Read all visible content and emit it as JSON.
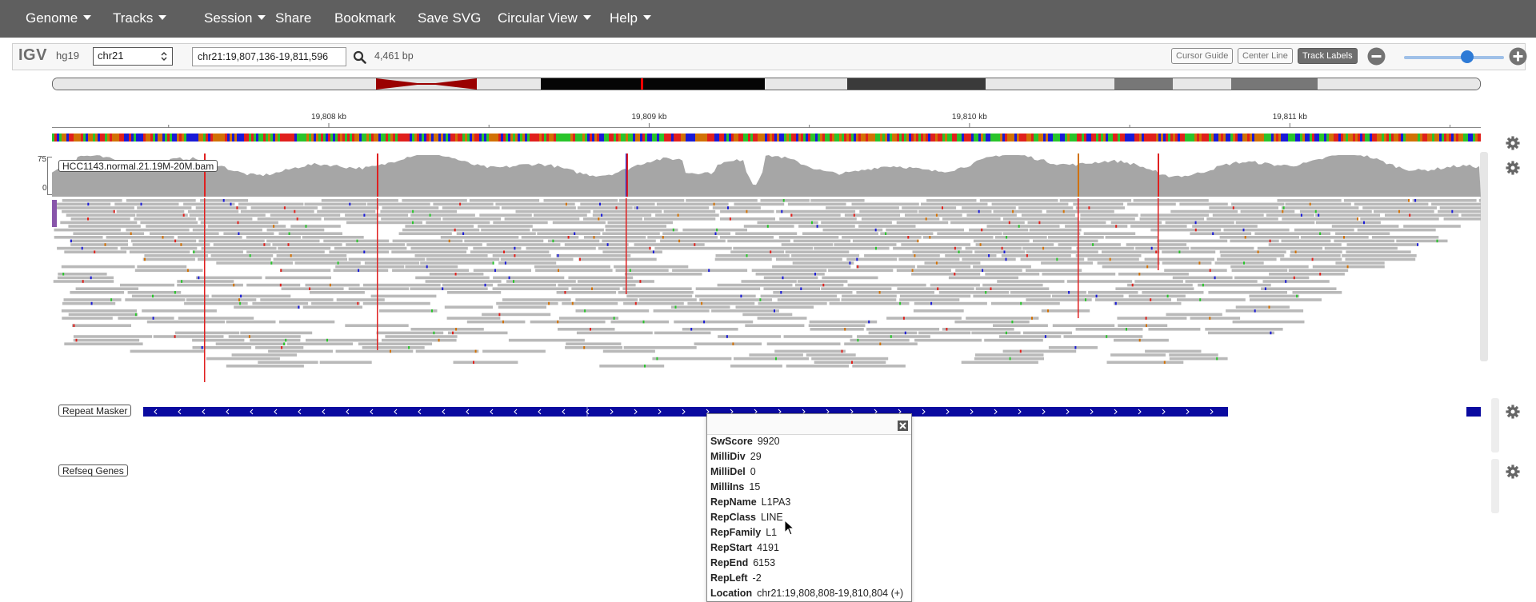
{
  "menu": {
    "items": [
      {
        "label": "Genome",
        "dropdown": true
      },
      {
        "label": "Tracks",
        "dropdown": true
      },
      {
        "label": "Session",
        "dropdown": true
      },
      {
        "label": "Share",
        "dropdown": false
      },
      {
        "label": "Bookmark",
        "dropdown": false
      },
      {
        "label": "Save SVG",
        "dropdown": false
      },
      {
        "label": "Circular View",
        "dropdown": true
      },
      {
        "label": "Help",
        "dropdown": true
      }
    ]
  },
  "navbar": {
    "logo": "IGV",
    "genome": "hg19",
    "chromosome": "chr21",
    "locus": "chr21:19,807,136-19,811,596",
    "width_bp": "4,461 bp",
    "buttons": {
      "cursor_guide": "Cursor Guide",
      "center_line": "Center Line",
      "track_labels": "Track Labels"
    },
    "zoom_level": 0.68
  },
  "ruler": {
    "ticks": [
      {
        "label": "19,808 kb",
        "pos": 19808000
      },
      {
        "label": "19,809 kb",
        "pos": 19809000
      },
      {
        "label": "19,810 kb",
        "pos": 19810000
      },
      {
        "label": "19,811 kb",
        "pos": 19811000
      }
    ]
  },
  "locus_range": {
    "start": 19807136,
    "end": 19811596
  },
  "tracks": {
    "alignment": {
      "name": "HCC1143.normal.21.19M-20M.bam",
      "coverage_max": "75",
      "coverage_min": "0"
    },
    "repeats": {
      "name": "Repeat Masker"
    },
    "genes": {
      "name": "Refseq Genes"
    }
  },
  "popup": {
    "rows": [
      {
        "key": "SwScore",
        "value": "9920"
      },
      {
        "key": "MilliDiv",
        "value": "29"
      },
      {
        "key": "MilliDel",
        "value": "0"
      },
      {
        "key": "MilliIns",
        "value": "15"
      },
      {
        "key": "RepName",
        "value": "L1PA3"
      },
      {
        "key": "RepClass",
        "value": "LINE"
      },
      {
        "key": "RepFamily",
        "value": "L1"
      },
      {
        "key": "RepStart",
        "value": "4191"
      },
      {
        "key": "RepEnd",
        "value": "6153"
      },
      {
        "key": "RepLeft",
        "value": "-2"
      },
      {
        "key": "Location",
        "value": "chr21:19,808,808-19,810,804 (+)"
      }
    ]
  },
  "colors": {
    "topbar": "#5f5f5f",
    "repeat_feature": "#0a0aa0",
    "coverage": "#a6a6a6",
    "alignment": "#b9b9b9",
    "ideogram_centromere": "#9a0000",
    "ideogram_marker": "#ff0000"
  }
}
